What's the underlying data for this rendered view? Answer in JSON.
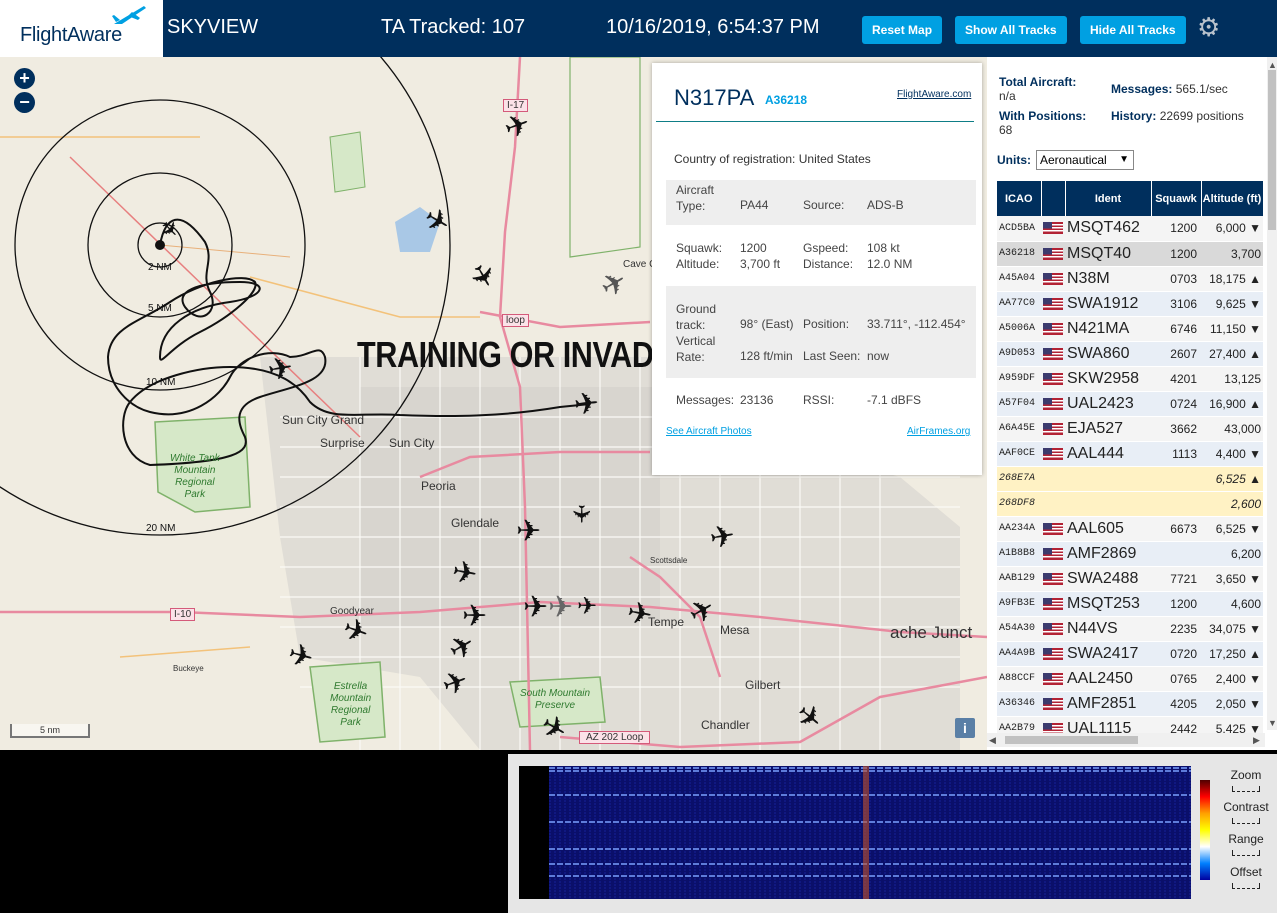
{
  "header": {
    "logo": "FlightAware",
    "app_name": "SKYVIEW",
    "tracked": "TA Tracked: 107",
    "datetime": "10/16/2019, 6:54:37 PM",
    "buttons": {
      "reset": "Reset Map",
      "show_all": "Show All Tracks",
      "hide_all": "Hide All Tracks"
    },
    "settings_icon": "gear-icon"
  },
  "map": {
    "zoom_in": "+",
    "zoom_out": "−",
    "overlay_text": "TRAINING OR INVADING",
    "scale": "5 nm",
    "info": "i",
    "range_rings": [
      "2 NM",
      "5 NM",
      "10 NM",
      "20 NM"
    ],
    "places": [
      "Sun City Grand",
      "Surprise",
      "Sun City",
      "Peoria",
      "Glendale",
      "Goodyear",
      "Buckeye",
      "Tempe",
      "Mesa",
      "Gilbert",
      "Chandler",
      "Scottsdale",
      "Cave C",
      "ache Junct",
      "Estrella Mountain Regional Park",
      "White Tank Mountain Regional Park",
      "South Mountain Preserve",
      "AZ 202 Loop",
      "I-17",
      "I-10",
      "loop"
    ],
    "park_labels": {
      "white_tank": "White Tank\nMountain\nRegional\nPark",
      "estrella": "Estrella\nMountain\nRegional\nPark",
      "south_mountain": "South Mountain\nPreserve"
    }
  },
  "popup": {
    "registration": "N317PA",
    "hex": "A36218",
    "fa_link": "FlightAware.com",
    "country_label": "Country of registration:",
    "country": "United States",
    "aircraft_type_label": "Aircraft Type:",
    "aircraft_type": "PA44",
    "source_label": "Source:",
    "source": "ADS-B",
    "squawk_label": "Squawk:",
    "squawk": "1200",
    "gspeed_label": "Gspeed:",
    "gspeed": "108 kt",
    "altitude_label": "Altitude:",
    "altitude": "3,700 ft",
    "distance_label": "Distance:",
    "distance": "12.0 NM",
    "track_label": "Ground track:",
    "track": "98° (East)",
    "position_label": "Position:",
    "position": "33.711°, -112.454°",
    "vrate_label": "Vertical Rate:",
    "vrate": "128 ft/min",
    "last_seen_label": "Last Seen:",
    "last_seen": "now",
    "messages_label": "Messages:",
    "messages": "23136",
    "rssi_label": "RSSI:",
    "rssi": "-7.1 dBFS",
    "photos_link": "See Aircraft Photos",
    "airframes_link": "AirFrames.org"
  },
  "panel": {
    "total_label": "Total Aircraft:",
    "total": "n/a",
    "msgs_label": "Messages:",
    "msgs": "565.1/sec",
    "withpos_label": "With Positions:",
    "withpos": "68",
    "history_label": "History:",
    "history": "22699 positions",
    "units_label": "Units:",
    "units": "Aeronautical",
    "columns": [
      "ICAO",
      "",
      "Ident",
      "Squawk",
      "Altitude (ft)"
    ],
    "rows": [
      {
        "icao": "ACD5BA",
        "flag": true,
        "ident": "MSQT462",
        "squawk": "1200",
        "alt": "6,000 ▼",
        "kind": "odd"
      },
      {
        "icao": "A36218",
        "flag": true,
        "ident": "MSQT40",
        "squawk": "1200",
        "alt": "3,700",
        "kind": "sel"
      },
      {
        "icao": "A45A04",
        "flag": true,
        "ident": "N38M",
        "squawk": "0703",
        "alt": "18,175 ▲",
        "kind": "odd"
      },
      {
        "icao": "AA77C0",
        "flag": true,
        "ident": "SWA1912",
        "squawk": "3106",
        "alt": "9,625 ▼",
        "kind": "even"
      },
      {
        "icao": "A5006A",
        "flag": true,
        "ident": "N421MA",
        "squawk": "6746",
        "alt": "11,150 ▼",
        "kind": "odd"
      },
      {
        "icao": "A9D053",
        "flag": true,
        "ident": "SWA860",
        "squawk": "2607",
        "alt": "27,400 ▲",
        "kind": "even"
      },
      {
        "icao": "A959DF",
        "flag": true,
        "ident": "SKW2958",
        "squawk": "4201",
        "alt": "13,125",
        "kind": "odd"
      },
      {
        "icao": "A57F04",
        "flag": true,
        "ident": "UAL2423",
        "squawk": "0724",
        "alt": "16,900 ▲",
        "kind": "even"
      },
      {
        "icao": "A6A45E",
        "flag": true,
        "ident": "EJA527",
        "squawk": "3662",
        "alt": "43,000",
        "kind": "odd"
      },
      {
        "icao": "AAF0CE",
        "flag": true,
        "ident": "AAL444",
        "squawk": "1113",
        "alt": "4,400 ▼",
        "kind": "even"
      },
      {
        "icao": "268E7A",
        "flag": false,
        "ident": "",
        "squawk": "",
        "alt": "6,525 ▲",
        "kind": "mlat"
      },
      {
        "icao": "268DF8",
        "flag": false,
        "ident": "",
        "squawk": "",
        "alt": "2,600",
        "kind": "mlat"
      },
      {
        "icao": "AA234A",
        "flag": true,
        "ident": "AAL605",
        "squawk": "6673",
        "alt": "6,525 ▼",
        "kind": "odd"
      },
      {
        "icao": "A1B8B8",
        "flag": true,
        "ident": "AMF2869",
        "squawk": "",
        "alt": "6,200",
        "kind": "even"
      },
      {
        "icao": "AAB129",
        "flag": true,
        "ident": "SWA2488",
        "squawk": "7721",
        "alt": "3,650 ▼",
        "kind": "odd"
      },
      {
        "icao": "A9FB3E",
        "flag": true,
        "ident": "MSQT253",
        "squawk": "1200",
        "alt": "4,600",
        "kind": "even"
      },
      {
        "icao": "A54A30",
        "flag": true,
        "ident": "N44VS",
        "squawk": "2235",
        "alt": "34,075 ▼",
        "kind": "odd"
      },
      {
        "icao": "AA4A9B",
        "flag": true,
        "ident": "SWA2417",
        "squawk": "0720",
        "alt": "17,250 ▲",
        "kind": "even"
      },
      {
        "icao": "A88CCF",
        "flag": true,
        "ident": "AAL2450",
        "squawk": "0765",
        "alt": "2,400 ▼",
        "kind": "odd"
      },
      {
        "icao": "A36346",
        "flag": true,
        "ident": "AMF2851",
        "squawk": "4205",
        "alt": "2,050 ▼",
        "kind": "even"
      },
      {
        "icao": "AA2B79",
        "flag": true,
        "ident": "UAL1115",
        "squawk": "2442",
        "alt": "5,425 ▼",
        "kind": "odd"
      }
    ]
  },
  "waterfall": {
    "controls": [
      "Zoom",
      "Contrast",
      "Range",
      "Offset"
    ]
  }
}
